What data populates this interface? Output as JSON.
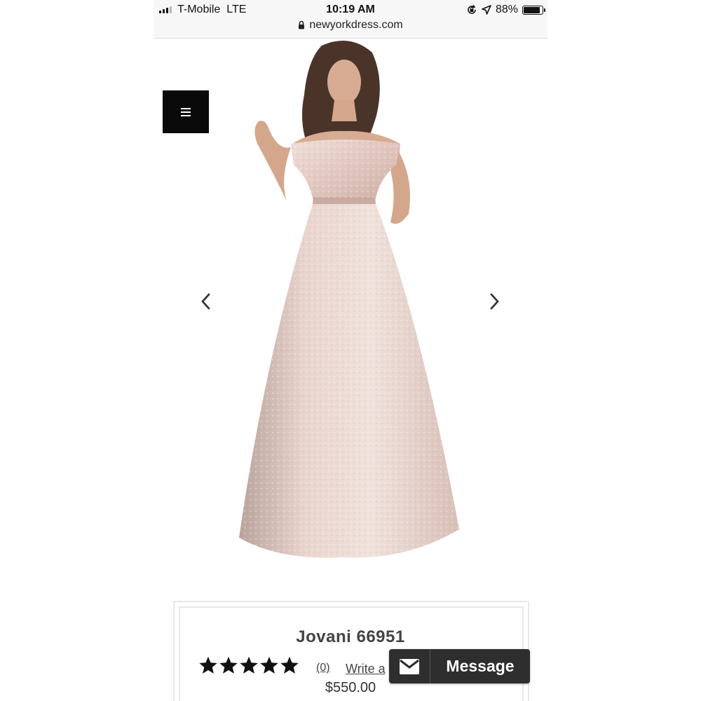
{
  "status_bar": {
    "carrier": "T-Mobile  LTE",
    "time": "10:19 AM",
    "url": "newyorkdress.com",
    "battery": "88%",
    "battery_level": 0.88
  },
  "hero": {
    "menu_icon": "hamburger-icon",
    "prev_icon": "chevron-left-icon",
    "next_icon": "chevron-right-icon"
  },
  "product": {
    "name": "Jovani 66951",
    "rating_stars": 5,
    "review_count": "(0)",
    "write_review": "Write a",
    "price": "$550.00"
  },
  "message_button": {
    "label": "Message",
    "icon": "envelope-icon"
  },
  "colors": {
    "menu_bg": "#0a0a0a",
    "message_bg": "#2e2e2e",
    "dress": "#e6cfc8"
  }
}
